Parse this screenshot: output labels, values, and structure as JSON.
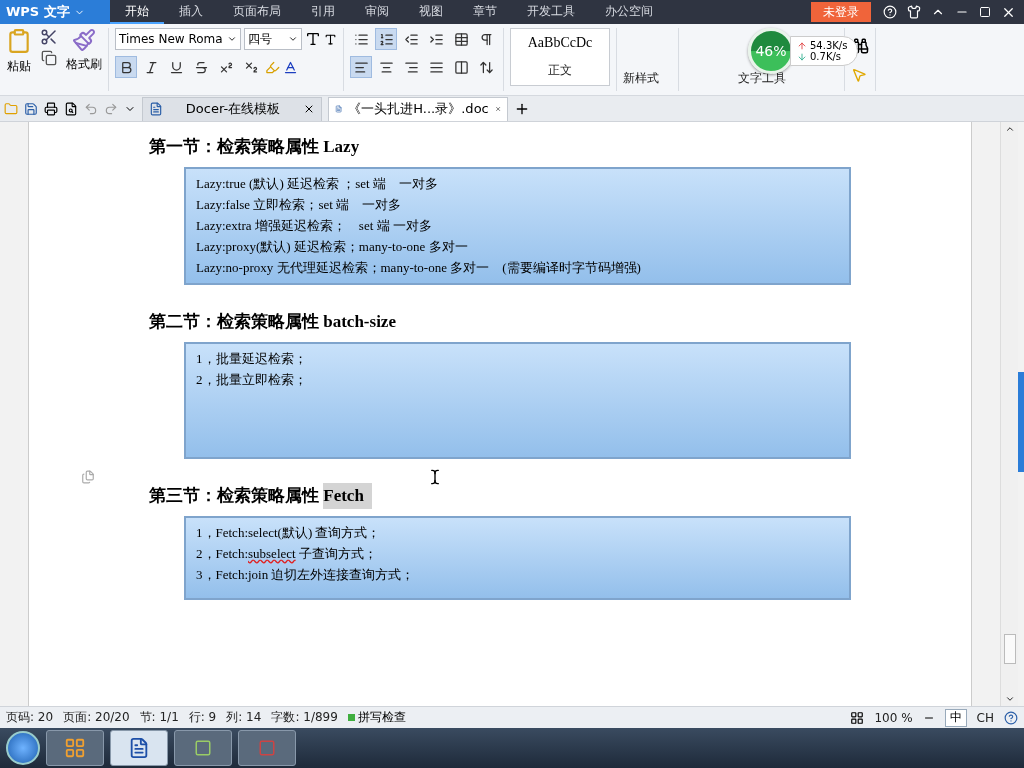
{
  "app_menu": {
    "label": "WPS 文字"
  },
  "menu_tabs": [
    {
      "label": "开始",
      "selected": true
    },
    {
      "label": "插入",
      "selected": false
    },
    {
      "label": "页面布局",
      "selected": false
    },
    {
      "label": "引用",
      "selected": false
    },
    {
      "label": "审阅",
      "selected": false
    },
    {
      "label": "视图",
      "selected": false
    },
    {
      "label": "章节",
      "selected": false
    },
    {
      "label": "开发工具",
      "selected": false
    },
    {
      "label": "办公空间",
      "selected": false
    }
  ],
  "login_button": "未登录",
  "ribbon": {
    "paste": "粘贴",
    "format_painter": "格式刷",
    "font": "Times New Roma",
    "size": "四号",
    "font_buttons": [
      {
        "kind": "bold",
        "on": true
      },
      {
        "kind": "italic",
        "on": false
      },
      {
        "kind": "underline",
        "on": false
      },
      {
        "kind": "strike",
        "on": false
      },
      {
        "kind": "superscript",
        "on": false
      },
      {
        "kind": "subscript",
        "on": false
      }
    ],
    "para_row1": [
      {
        "kind": "bullets",
        "on": false
      },
      {
        "kind": "numbering",
        "on": true
      },
      {
        "kind": "outdent",
        "on": false
      },
      {
        "kind": "indent",
        "on": false
      },
      {
        "kind": "table",
        "on": false
      },
      {
        "kind": "marks",
        "on": false
      }
    ],
    "para_row2": [
      {
        "kind": "align-left",
        "on": true
      },
      {
        "kind": "align-center",
        "on": false
      },
      {
        "kind": "align-right",
        "on": false
      },
      {
        "kind": "justify",
        "on": false
      },
      {
        "kind": "distribute",
        "on": false
      },
      {
        "kind": "spacing",
        "on": false
      }
    ],
    "style_preview": "AaBbCcDc",
    "style_name": "正文",
    "new_style": "新样式",
    "text_tools": "文字工具"
  },
  "net_widget": {
    "percent": "46%",
    "up": "54.3K/s",
    "down": "0.7K/s"
  },
  "doc_tabs": [
    {
      "label": "Docer-在线模板",
      "selected": false
    },
    {
      "label": "《一头扎进H...录》.doc",
      "selected": true
    }
  ],
  "sections": [
    {
      "heading": "第一节：检索策略属性 Lazy",
      "lines": [
        {
          "text": "Lazy:true (默认) 延迟检索 ；set 端　一对多"
        },
        {
          "text": "Lazy:false 立即检索；set 端　一对多"
        },
        {
          "text": "Lazy:extra 增强延迟检索；　set 端 一对多"
        },
        {
          "text": "Lazy:proxy(默认) 延迟检索；many-to-one 多对一"
        },
        {
          "text": "Lazy:no-proxy 无代理延迟检索；many-to-one 多对一　(需要编译时字节码增强)"
        }
      ]
    },
    {
      "heading": "第二节：检索策略属性 batch-size",
      "lines": [
        {
          "text": "1，批量延迟检索；"
        },
        {
          "text": "2，批量立即检索；"
        }
      ]
    },
    {
      "heading": "第三节：检索策略属性 ",
      "selected_text": "Fetch",
      "lines": [
        {
          "text": "1，Fetch:select(默认) 查询方式；"
        },
        {
          "text": "2，Fetch:",
          "misspelled": "subselect",
          "after": " 子查询方式；"
        },
        {
          "text": "3，Fetch:join 迫切左外连接查询方式；"
        }
      ]
    }
  ],
  "status_bar": {
    "items": [
      "页码: 20",
      "页面: 20/20",
      "节: 1/1",
      "行: 9",
      "列: 14",
      "字数: 1/899"
    ],
    "spell_check": "拼写检查",
    "zoom": "100 %",
    "ime": "中",
    "lang": "CH"
  }
}
